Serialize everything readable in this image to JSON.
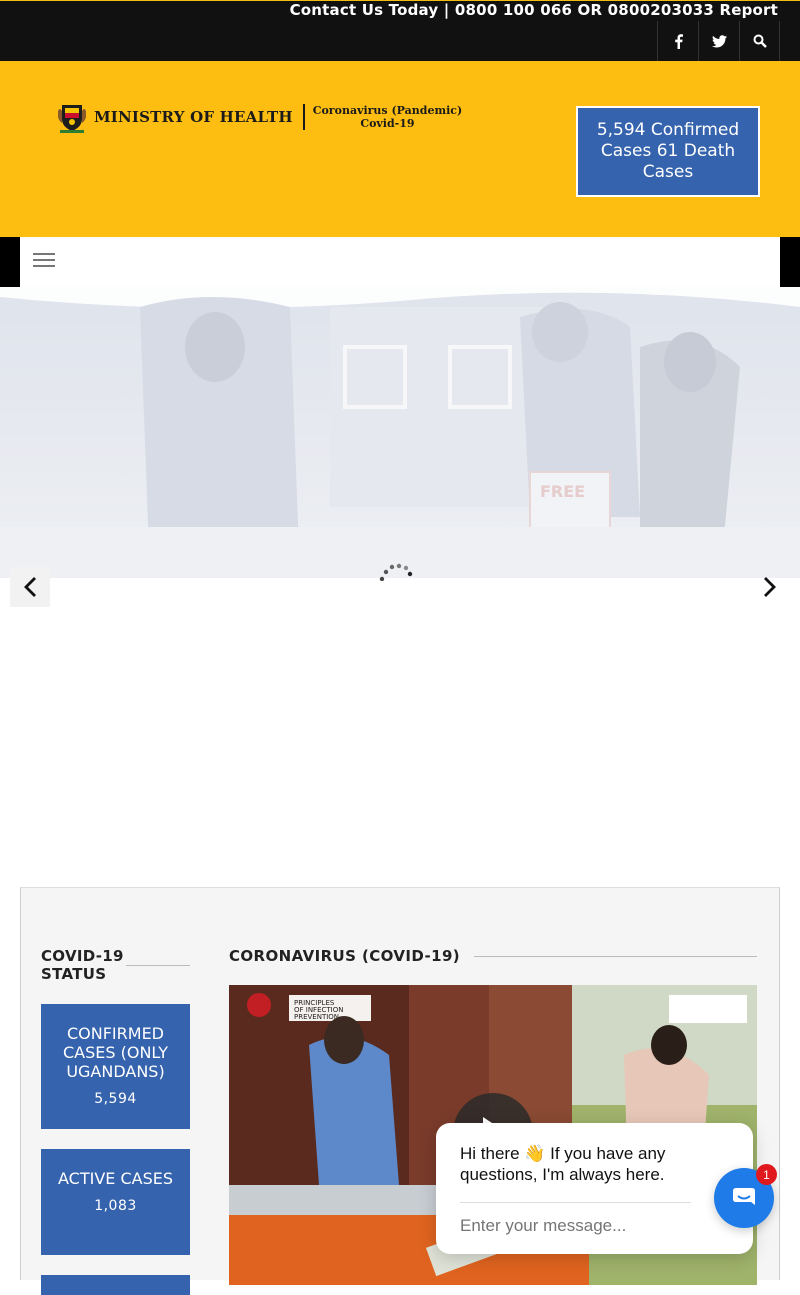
{
  "topbar": {
    "contact_text": "Contact Us Today | 0800 100 066 OR 0800203033 Report",
    "icons": [
      "facebook-icon",
      "twitter-icon",
      "search-icon"
    ]
  },
  "header": {
    "logo_title": "MINISTRY OF HEALTH",
    "logo_sub1": "Coronavirus (Pandemic)",
    "logo_sub2": "Covid-19",
    "cases_banner": "5,594 Confirmed Cases 61 Death Cases"
  },
  "hero": {
    "slide_text": "FREE"
  },
  "sidebar": {
    "title": "COVID-19 STATUS",
    "stats": [
      {
        "label": "CONFIRMED CASES (ONLY UGANDANS)",
        "value": "5,594"
      },
      {
        "label": "ACTIVE CASES",
        "value": "1,083"
      }
    ]
  },
  "main": {
    "section_title": "CORONAVIRUS (COVID-19)",
    "video_caption_1": "PRINCIPLES",
    "video_caption_2": "OF INFECTION",
    "video_caption_3": "PREVENTION"
  },
  "chat": {
    "greeting": "Hi there 👋 If you have any questions, I'm always here.",
    "placeholder": "Enter your message...",
    "badge": "1"
  },
  "colors": {
    "brand_yellow": "#fdbd11",
    "brand_blue": "#3563ad",
    "chat_blue": "#1e7be8",
    "badge_red": "#e0191e"
  }
}
